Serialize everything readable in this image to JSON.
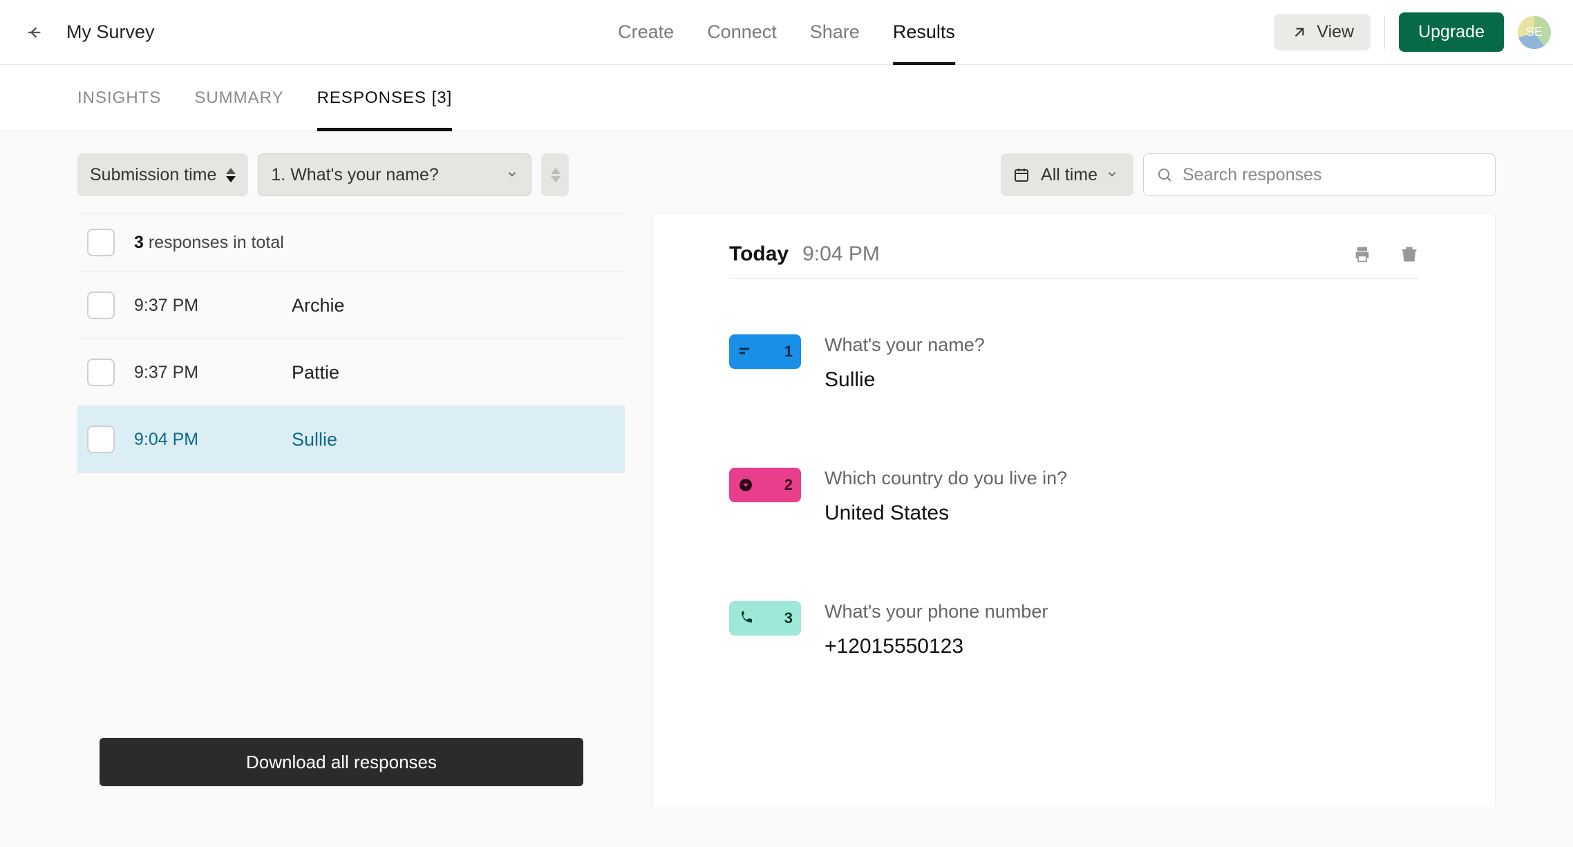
{
  "header": {
    "title": "My Survey",
    "tabs": [
      "Create",
      "Connect",
      "Share",
      "Results"
    ],
    "active_tab": 3,
    "view_label": "View",
    "upgrade_label": "Upgrade",
    "avatar_initials": "SE"
  },
  "subtabs": {
    "items": [
      "Insights",
      "Summary",
      "Responses [3]"
    ],
    "active": 2
  },
  "toolbar": {
    "sort_by": "Submission time",
    "question_filter": "1. What's your name?",
    "date_filter": "All time",
    "search_placeholder": "Search responses"
  },
  "list": {
    "total_count": "3",
    "total_suffix": "responses in total",
    "rows": [
      {
        "time": "9:37 PM",
        "name": "Archie",
        "selected": false
      },
      {
        "time": "9:37 PM",
        "name": "Pattie",
        "selected": false
      },
      {
        "time": "9:04 PM",
        "name": "Sullie",
        "selected": true
      }
    ],
    "download_label": "Download all responses"
  },
  "detail": {
    "date_label": "Today",
    "time_label": "9:04 PM",
    "answers": [
      {
        "num": "1",
        "question": "What's your name?",
        "answer": "Sullie",
        "type": "text"
      },
      {
        "num": "2",
        "question": "Which country do you live in?",
        "answer": "United States",
        "type": "dropdown"
      },
      {
        "num": "3",
        "question": "What's your phone number",
        "answer": "+12015550123",
        "type": "phone"
      }
    ]
  }
}
